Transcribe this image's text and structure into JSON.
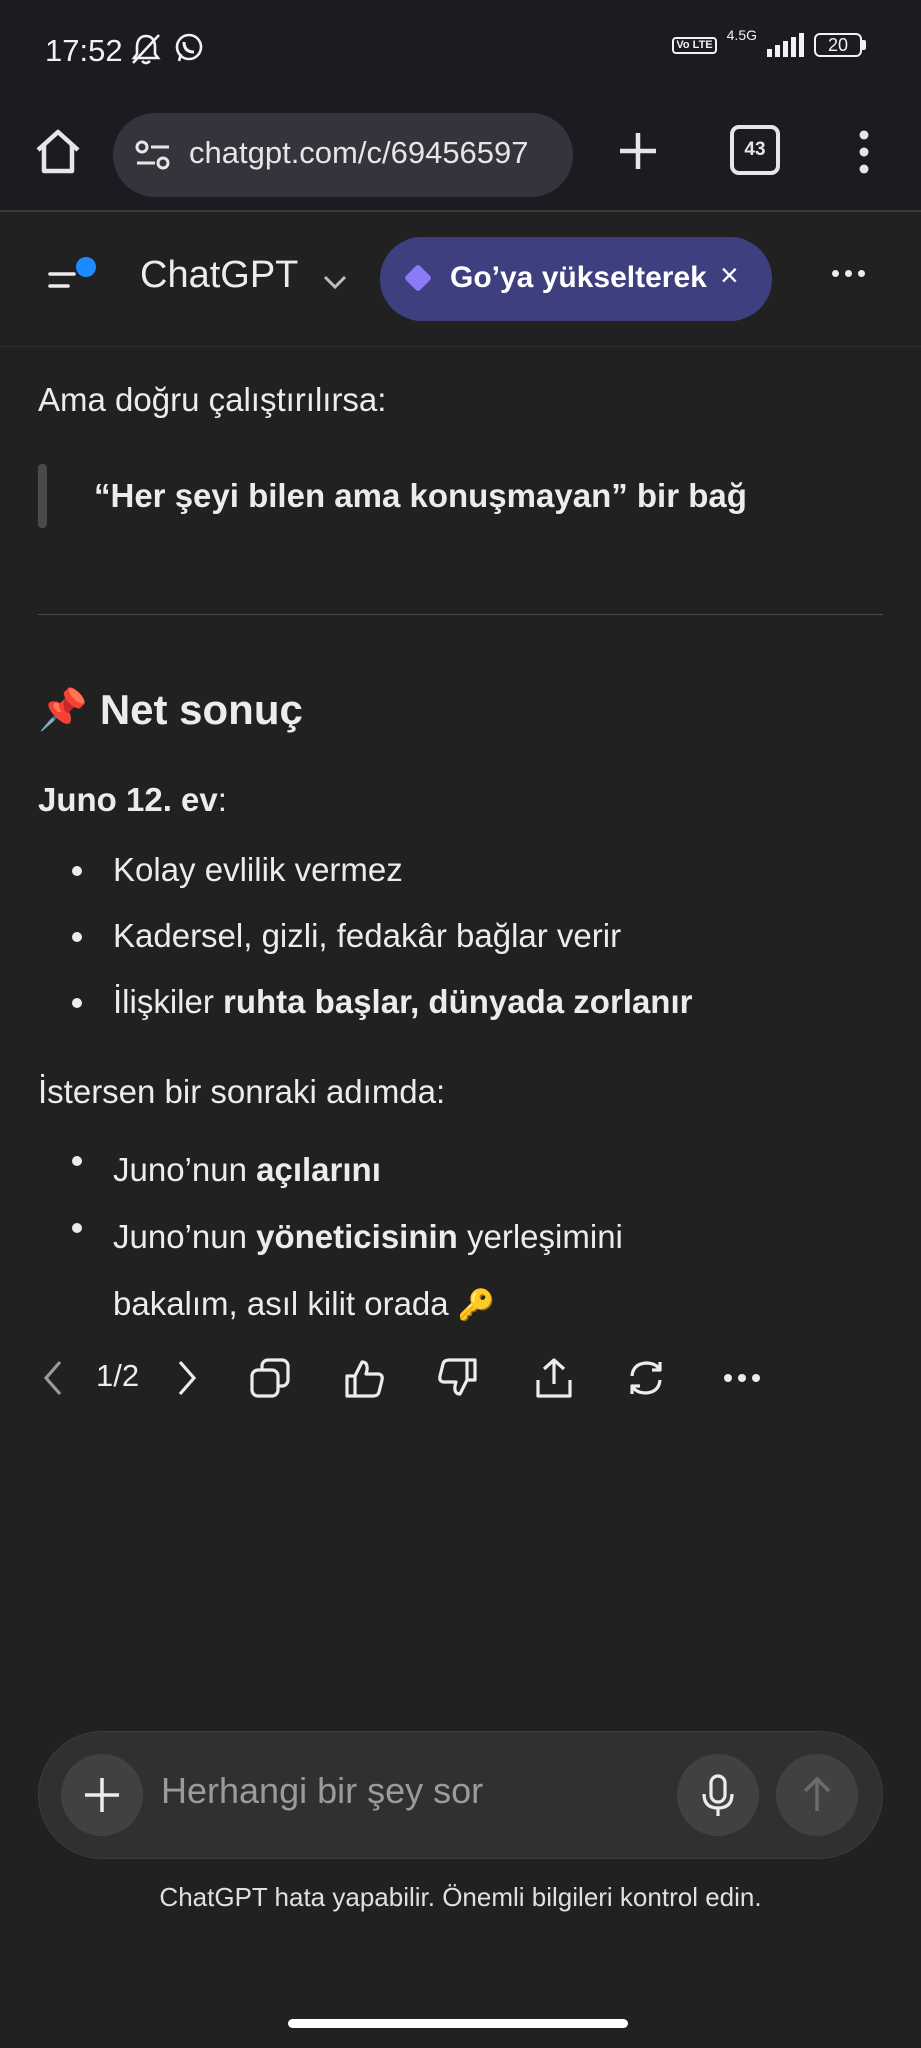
{
  "status_bar": {
    "time": "17:52",
    "icons": [
      "bell-off-icon",
      "whatsapp-icon"
    ],
    "volte": "Vo LTE",
    "network": "4.5G",
    "battery": "20"
  },
  "browser": {
    "url": "chatgpt.com/c/69456597",
    "tab_count": "43",
    "icons": [
      "home-icon",
      "tune-icon",
      "plus-icon",
      "more-vert-icon"
    ]
  },
  "header": {
    "title": "ChatGPT",
    "upgrade_label": "Go’ya yükselterek",
    "close": "×"
  },
  "message": {
    "intro": "Ama doğru çalıştırılırsa:",
    "quote": "“Her şeyi bilen ama konuşmayan” bir bağ",
    "heading_icon": "📌",
    "heading": "Net sonuç",
    "juno_bold": "Juno 12. ev",
    "juno_rest": ":",
    "list1": [
      {
        "plain": "Kolay evlilik vermez"
      },
      {
        "plain": "Kadersel, gizli, fedakâr bağlar verir"
      },
      {
        "plain": "İlişkiler ",
        "bold": "ruhta başlar, dünyada zorlanır"
      }
    ],
    "ister": "İstersen bir sonraki adımda:",
    "list2": [
      {
        "plain": "Juno’nun ",
        "bold": "açılarını"
      },
      {
        "plain": "Juno’nun ",
        "bold": "yöneticisinin",
        "rest": " yerleşimini bakalım, asıl kilit orada ",
        "emoji": "🔑"
      }
    ]
  },
  "actions": {
    "pager": "1/2",
    "icons": [
      "chevron-left-icon",
      "chevron-right-icon",
      "copy-icon",
      "thumbs-up-icon",
      "thumbs-down-icon",
      "share-icon",
      "regenerate-icon",
      "more-horizontal-icon"
    ]
  },
  "composer": {
    "placeholder": "Herhangi bir şey sor",
    "disclaimer": "ChatGPT hata yapabilir. Önemli bilgileri kontrol edin."
  },
  "colors": {
    "background": "#212121",
    "chrome": "#1b1c22",
    "upgrade_pill": "#3d3f7e",
    "accent_dot": "#1a8cff"
  }
}
